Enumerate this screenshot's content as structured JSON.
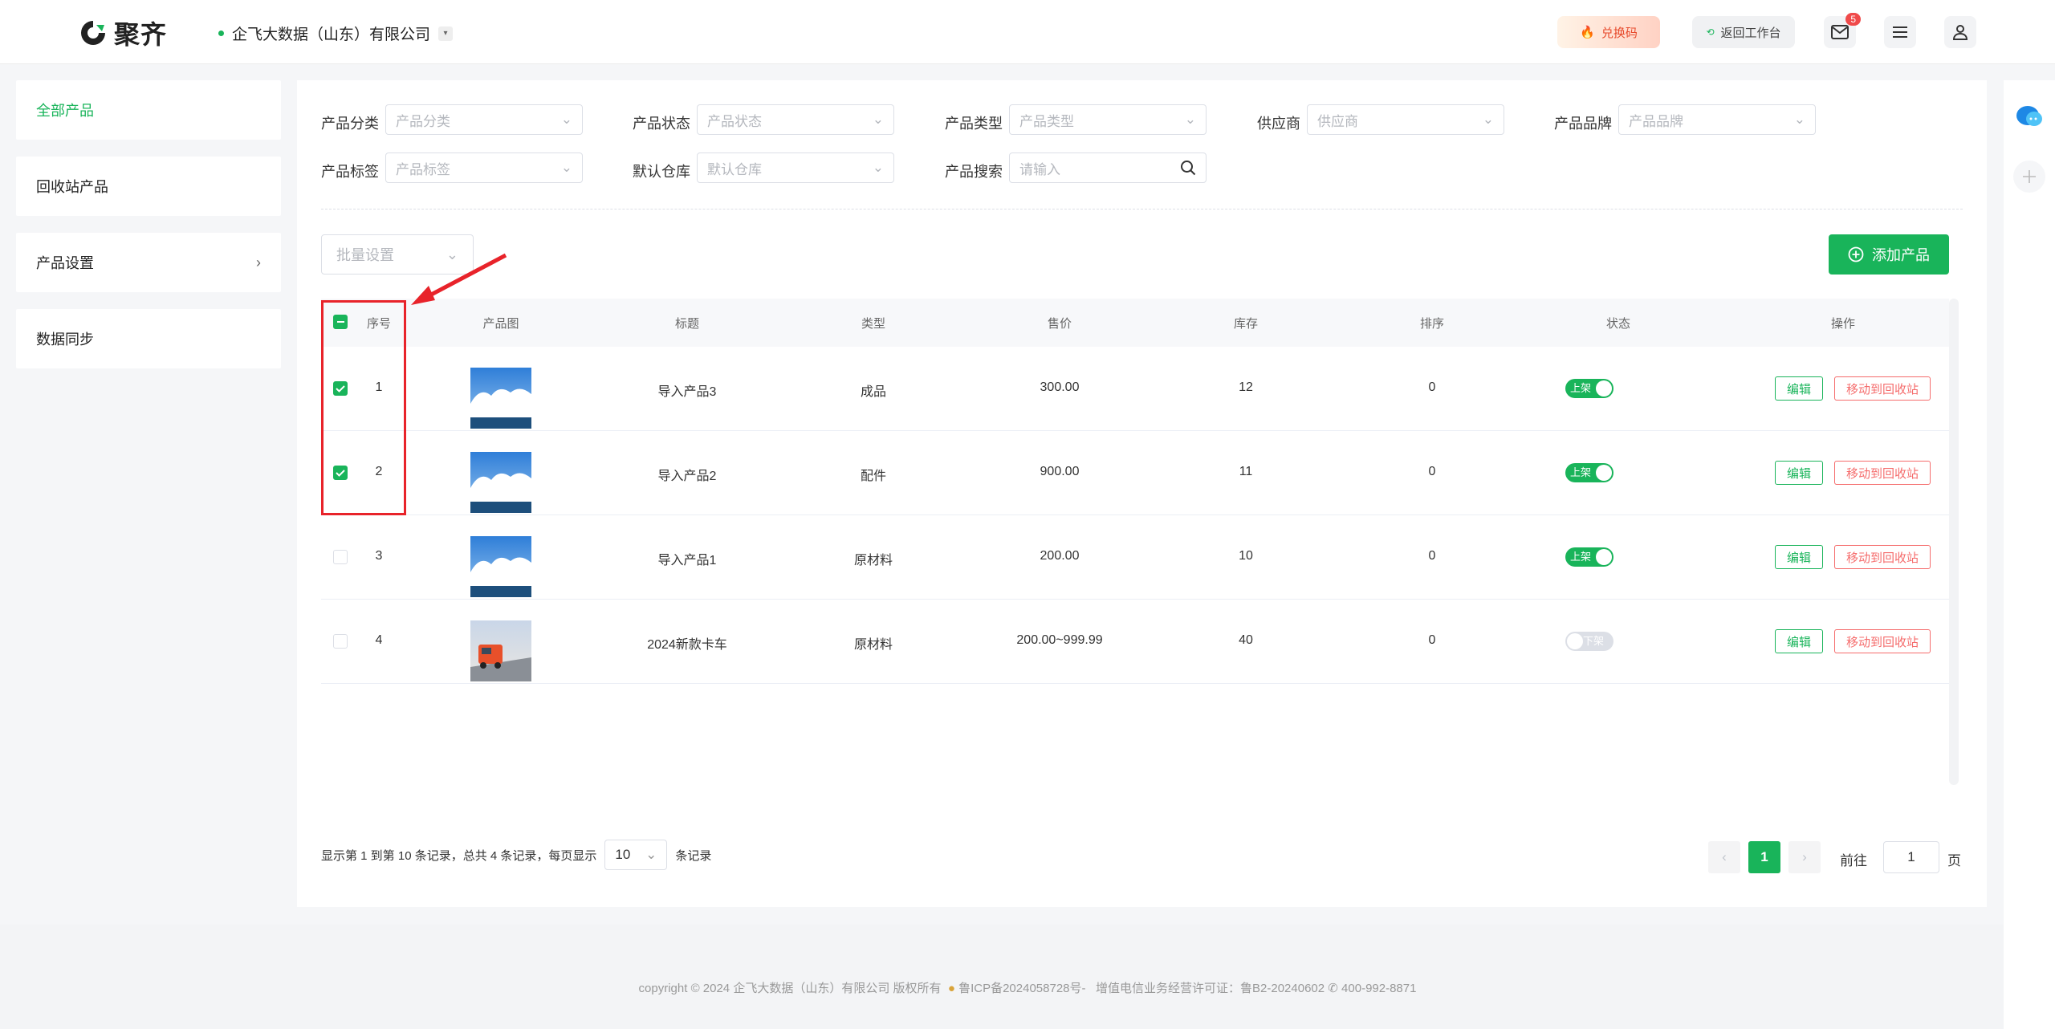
{
  "header": {
    "logo_text": "聚齐",
    "company": "企飞大数据（山东）有限公司",
    "redeem_label": "兑换码",
    "back_label": "返回工作台",
    "mail_badge": "5"
  },
  "sidebar": {
    "items": [
      {
        "label": "全部产品",
        "active": true
      },
      {
        "label": "回收站产品"
      },
      {
        "label": "产品设置",
        "has_arrow": true
      },
      {
        "label": "数据同步"
      }
    ]
  },
  "filters": {
    "category_label": "产品分类",
    "category_placeholder": "产品分类",
    "status_label": "产品状态",
    "status_placeholder": "产品状态",
    "type_label": "产品类型",
    "type_placeholder": "产品类型",
    "supplier_label": "供应商",
    "supplier_placeholder": "供应商",
    "brand_label": "产品品牌",
    "brand_placeholder": "产品品牌",
    "tag_label": "产品标签",
    "tag_placeholder": "产品标签",
    "warehouse_label": "默认仓库",
    "warehouse_placeholder": "默认仓库",
    "search_label": "产品搜索",
    "search_placeholder": "请输入"
  },
  "toolbar": {
    "batch_placeholder": "批量设置",
    "add_label": "添加产品"
  },
  "table": {
    "headers": [
      "序号",
      "产品图",
      "标题",
      "类型",
      "售价",
      "库存",
      "排序",
      "状态",
      "操作"
    ],
    "rows": [
      {
        "index": "1",
        "title": "导入产品3",
        "type": "成品",
        "price": "300.00",
        "stock": "12",
        "sort": "0",
        "status": "上架",
        "on": true,
        "checked": true
      },
      {
        "index": "2",
        "title": "导入产品2",
        "type": "配件",
        "price": "900.00",
        "stock": "11",
        "sort": "0",
        "status": "上架",
        "on": true,
        "checked": true
      },
      {
        "index": "3",
        "title": "导入产品1",
        "type": "原材料",
        "price": "200.00",
        "stock": "10",
        "sort": "0",
        "status": "上架",
        "on": true,
        "checked": false
      },
      {
        "index": "4",
        "title": "2024新款卡车",
        "type": "原材料",
        "price": "200.00~999.99",
        "stock": "40",
        "sort": "0",
        "status": "下架",
        "on": false,
        "checked": false
      }
    ],
    "edit_label": "编辑",
    "trash_label": "移动到回收站"
  },
  "pagination": {
    "info": "显示第 1 到第 10 条记录，总共 4 条记录，每页显示",
    "page_size": "10",
    "records_suffix": "条记录",
    "current_page": "1",
    "goto_label": "前往",
    "goto_value": "1",
    "page_suffix": "页"
  },
  "footer": {
    "copyright": "copyright © 2024 企飞大数据（山东）有限公司 版权所有",
    "icp": "鲁ICP备2024058728号-",
    "license": "增值电信业务经营许可证：鲁B2-20240602",
    "phone": "400-992-8871"
  },
  "colors": {
    "accent": "#19b45a",
    "danger": "#f56c6c",
    "annotation": "#e8232a"
  }
}
